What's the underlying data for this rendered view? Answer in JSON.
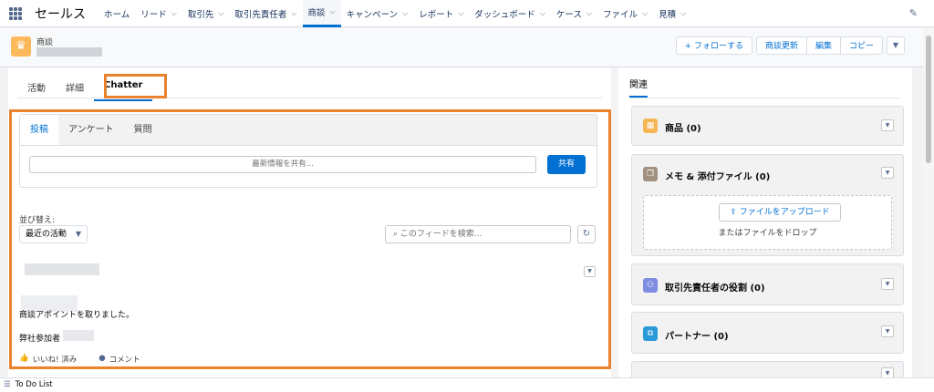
{
  "nav": {
    "app_name": "セールス",
    "items": [
      {
        "label": "ホーム",
        "chevron": false
      },
      {
        "label": "リード",
        "chevron": true
      },
      {
        "label": "取引先",
        "chevron": true
      },
      {
        "label": "取引先責任者",
        "chevron": true
      },
      {
        "label": "商談",
        "chevron": true,
        "active": true
      },
      {
        "label": "キャンペーン",
        "chevron": true
      },
      {
        "label": "レポート",
        "chevron": true
      },
      {
        "label": "ダッシュボード",
        "chevron": true
      },
      {
        "label": "ケース",
        "chevron": true
      },
      {
        "label": "ファイル",
        "chevron": true
      },
      {
        "label": "見積",
        "chevron": true
      }
    ]
  },
  "header": {
    "object_label": "商談",
    "follow_button": "フォローする",
    "update_button": "商談更新",
    "edit_button": "編集",
    "copy_button": "コピー"
  },
  "tabs": {
    "activity": "活動",
    "details": "詳細",
    "chatter": "Chatter"
  },
  "publisher": {
    "tabs": {
      "post": "投稿",
      "survey": "アンケート",
      "question": "質問"
    },
    "placeholder": "最新情報を共有...",
    "share_button": "共有"
  },
  "feed": {
    "sort_label": "並び替え:",
    "sort_value": "最近の活動",
    "search_placeholder": "このフィードを検索...",
    "post_text": "商談アポイントを取りました。",
    "post_sub": "弊社参加者",
    "like_label": "いいね! 済み",
    "comment_label": "コメント"
  },
  "related": {
    "tab": "関連",
    "cards": {
      "products": {
        "title": "商品 (0)",
        "color": "#f5b656"
      },
      "notes": {
        "title": "メモ & 添付ファイル (0)",
        "color": "#a09080",
        "upload_button": "ファイルをアップロード",
        "drop_text": "またはファイルをドロップ"
      },
      "contact_roles": {
        "title": "取引先責任者の役割 (0)",
        "color": "#7f8de1"
      },
      "partners": {
        "title": "パートナー (0)",
        "color": "#2a9ad8"
      }
    }
  },
  "footer": {
    "label": "To Do List"
  },
  "colors": {
    "accent": "#0070d2",
    "highlight": "#e8822f"
  }
}
